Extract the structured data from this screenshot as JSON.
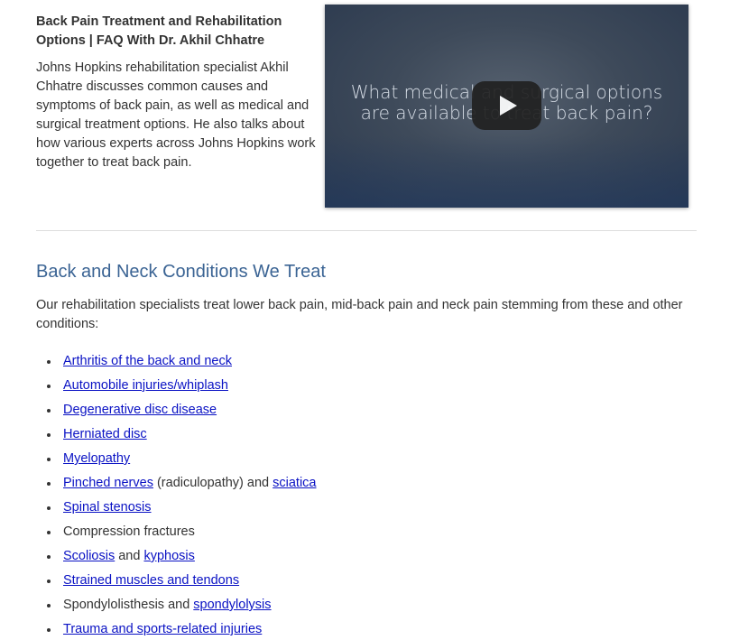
{
  "video": {
    "title": "Back Pain Treatment and Rehabilitation Options | FAQ With Dr. Akhil Chhatre",
    "description": "Johns Hopkins rehabilitation specialist Akhil Chhatre discusses common causes and symptoms of back pain, as well as medical and surgical treatment options. He also talks about how various experts across Johns Hopkins work together to treat back pain.",
    "caption_line1": "What medical and surgical options",
    "caption_line2": "are available to treat back pain?",
    "play_icon": "play-icon"
  },
  "section": {
    "heading": "Back and Neck Conditions We Treat",
    "intro": "Our rehabilitation specialists treat lower back pain, mid-back pain and neck pain stemming from these and other conditions:"
  },
  "conditions": [
    {
      "link": "Arthritis of the back and neck"
    },
    {
      "link": "Automobile injuries/whiplash"
    },
    {
      "link": "Degenerative disc disease"
    },
    {
      "link": "Herniated disc"
    },
    {
      "link": "Myelopathy"
    },
    {
      "link": "Pinched nerves",
      "text": " (radiculopathy) and ",
      "link2": "sciatica"
    },
    {
      "link": "Spinal stenosis"
    },
    {
      "text": "Compression fractures"
    },
    {
      "link": "Scoliosis",
      "text": " and ",
      "link2": "kyphosis"
    },
    {
      "link": "Strained muscles and tendons"
    },
    {
      "text": "Spondylolisthesis and ",
      "link2": "spondylolysis"
    },
    {
      "link": "Trauma and sports-related injuries"
    }
  ],
  "colors": {
    "link": "#0a12c4",
    "heading": "#3b6494",
    "body_text": "#333333"
  }
}
